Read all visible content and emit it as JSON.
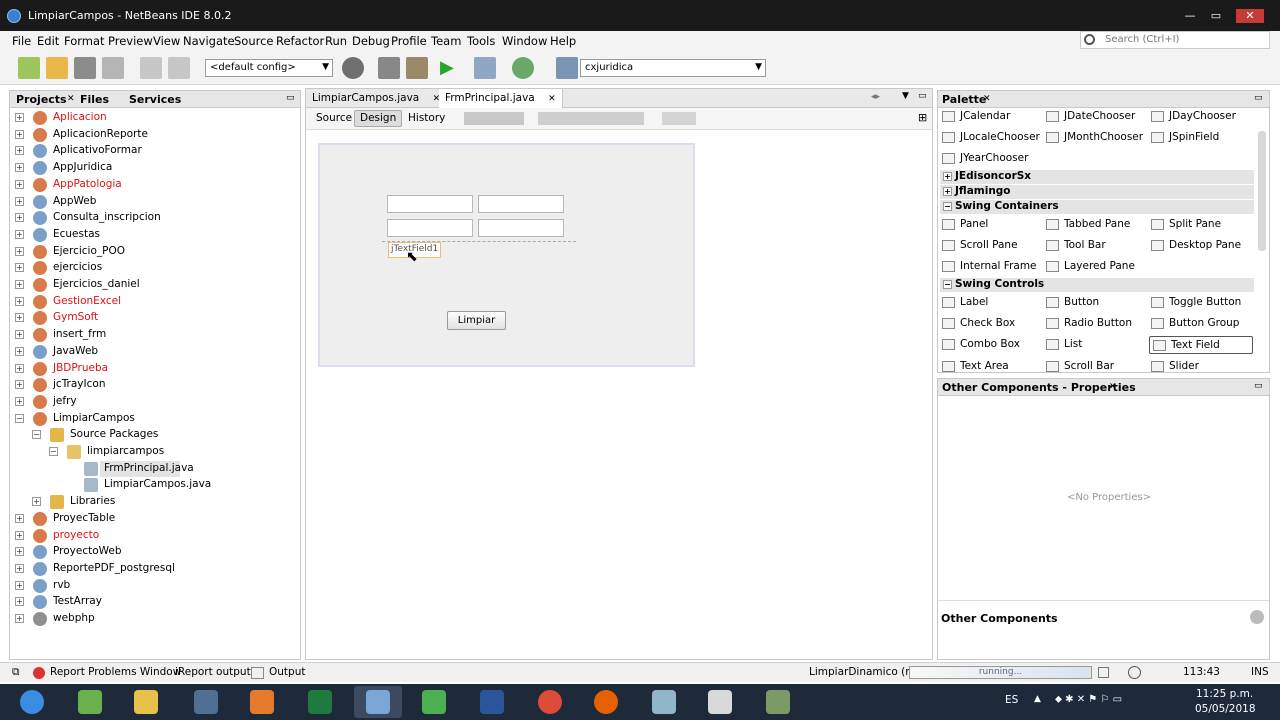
{
  "window": {
    "title": "LimpiarCampos - NetBeans IDE 8.0.2",
    "controls": {
      "minimize": "—",
      "maximize": "▭",
      "close": "✕"
    }
  },
  "menu": [
    "File",
    "Edit",
    "Format",
    "Preview",
    "View",
    "Navigate",
    "Source",
    "Refactor",
    "Run",
    "Debug",
    "Profile",
    "Team",
    "Tools",
    "Window",
    "Help"
  ],
  "search": {
    "placeholder": "Search (Ctrl+I)"
  },
  "toolbar": {
    "config": "<default config>",
    "project": "cxjuridica"
  },
  "left_panel": {
    "tabs": [
      "Projects",
      "Files",
      "Services"
    ],
    "tree": [
      {
        "label": "Aplicacion",
        "error": true,
        "type": "app",
        "indent": 0
      },
      {
        "label": "AplicacionReporte",
        "error": false,
        "type": "app",
        "indent": 0
      },
      {
        "label": "AplicativoFormar",
        "error": false,
        "type": "web",
        "indent": 0
      },
      {
        "label": "AppJuridica",
        "error": false,
        "type": "web",
        "indent": 0
      },
      {
        "label": "AppPatologia",
        "error": true,
        "type": "app",
        "indent": 0
      },
      {
        "label": "AppWeb",
        "error": false,
        "type": "web",
        "indent": 0
      },
      {
        "label": "Consulta_inscripcion",
        "error": false,
        "type": "web",
        "indent": 0
      },
      {
        "label": "Ecuestas",
        "error": false,
        "type": "web",
        "indent": 0
      },
      {
        "label": "Ejercicio_POO",
        "error": false,
        "type": "app",
        "indent": 0
      },
      {
        "label": "ejercicios",
        "error": false,
        "type": "app",
        "indent": 0
      },
      {
        "label": "Ejercicios_daniel",
        "error": false,
        "type": "app",
        "indent": 0
      },
      {
        "label": "GestionExcel",
        "error": true,
        "type": "app",
        "indent": 0
      },
      {
        "label": "GymSoft",
        "error": true,
        "type": "app",
        "indent": 0
      },
      {
        "label": "insert_frm",
        "error": false,
        "type": "app",
        "indent": 0
      },
      {
        "label": "JavaWeb",
        "error": false,
        "type": "web",
        "indent": 0
      },
      {
        "label": "JBDPrueba",
        "error": true,
        "type": "app",
        "indent": 0
      },
      {
        "label": "jcTrayIcon",
        "error": false,
        "type": "app",
        "indent": 0
      },
      {
        "label": "jefry",
        "error": false,
        "type": "app",
        "indent": 0
      },
      {
        "label": "LimpiarCampos",
        "error": false,
        "type": "app",
        "indent": 0,
        "expanded": true
      },
      {
        "label": "Source Packages",
        "error": false,
        "type": "folder",
        "indent": 1,
        "expanded": true
      },
      {
        "label": "limpiarcampos",
        "error": false,
        "type": "package",
        "indent": 2,
        "expanded": true
      },
      {
        "label": "FrmPrincipal.java",
        "error": false,
        "type": "form",
        "indent": 3,
        "selected": true
      },
      {
        "label": "LimpiarCampos.java",
        "error": false,
        "type": "java",
        "indent": 3
      },
      {
        "label": "Libraries",
        "error": false,
        "type": "folder",
        "indent": 1
      },
      {
        "label": "ProyecTable",
        "error": false,
        "type": "app",
        "indent": 0
      },
      {
        "label": "proyecto",
        "error": true,
        "type": "app",
        "indent": 0
      },
      {
        "label": "ProyectoWeb",
        "error": false,
        "type": "web",
        "indent": 0
      },
      {
        "label": "ReportePDF_postgresql",
        "error": false,
        "type": "web",
        "indent": 0
      },
      {
        "label": "rvb",
        "error": false,
        "type": "web",
        "indent": 0
      },
      {
        "label": "TestArray",
        "error": false,
        "type": "web",
        "indent": 0
      },
      {
        "label": "webphp",
        "error": false,
        "type": "php",
        "indent": 0
      }
    ]
  },
  "editor": {
    "tabs": [
      "LimpiarCampos.java",
      "FrmPrincipal.java"
    ],
    "view_buttons": [
      "Source",
      "Design",
      "History"
    ],
    "form": {
      "textfield_label": "jTextField1",
      "button_label": "Limpiar"
    }
  },
  "palette": {
    "title": "Palette",
    "top_items": [
      [
        "JCalendar",
        "JDateChooser",
        "JDayChooser"
      ],
      [
        "JLocaleChooser",
        "JMonthChooser",
        "JSpinField"
      ],
      [
        "JYearChooser"
      ]
    ],
    "categories": {
      "c1": "JEdisoncorSx",
      "c2": "Jflamingo",
      "c3": "Swing Containers",
      "c4": "Swing Controls"
    },
    "containers": [
      [
        "Panel",
        "Tabbed Pane",
        "Split Pane"
      ],
      [
        "Scroll Pane",
        "Tool Bar",
        "Desktop Pane"
      ],
      [
        "Internal Frame",
        "Layered Pane"
      ]
    ],
    "controls": [
      [
        "Label",
        "Button",
        "Toggle Button"
      ],
      [
        "Check Box",
        "Radio Button",
        "Button Group"
      ],
      [
        "Combo Box",
        "List",
        "Text Field"
      ],
      [
        "Text Area",
        "Scroll Bar",
        "Slider"
      ]
    ]
  },
  "properties": {
    "title": "Other Components - Properties",
    "empty": "<No Properties>",
    "footer": "Other Components"
  },
  "statusbar": {
    "problems": "Report Problems Window",
    "ireport": "iReport output",
    "output": "Output",
    "run": "LimpiarDinamico (run)",
    "progress": "running...",
    "position": "113:43",
    "mode": "INS"
  },
  "taskbar": {
    "lang": "ES",
    "time": "11:25 p.m.",
    "date": "05/05/2018"
  },
  "colors": {
    "error": "#e01010",
    "accent": "#3b7fd4"
  }
}
